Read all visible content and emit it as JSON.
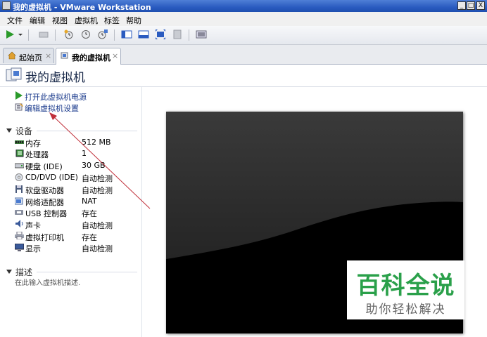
{
  "window": {
    "title": "我的虚拟机 - VMware Workstation",
    "minimize": "_",
    "maximize": "□",
    "close": "X"
  },
  "menu": [
    "文件",
    "编辑",
    "视图",
    "虚拟机",
    "标签",
    "帮助"
  ],
  "tabs": [
    {
      "label": "起始页",
      "close": "×",
      "active": false
    },
    {
      "label": "我的虚拟机",
      "close": "×",
      "active": true
    }
  ],
  "vm": {
    "title": "我的虚拟机"
  },
  "actions": {
    "power_on": "打开此虚拟机电源",
    "edit_settings": "编辑虚拟机设置"
  },
  "devices": {
    "heading": "设备",
    "items": [
      {
        "name": "内存",
        "value": "512 MB",
        "icon": "memory-icon"
      },
      {
        "name": "处理器",
        "value": "1",
        "icon": "processor-icon"
      },
      {
        "name": "硬盘 (IDE)",
        "value": "30 GB",
        "icon": "harddisk-icon"
      },
      {
        "name": "CD/DVD (IDE)",
        "value": "自动检测",
        "icon": "cdrom-icon"
      },
      {
        "name": "软盘驱动器",
        "value": "自动检测",
        "icon": "floppy-icon"
      },
      {
        "name": "网络适配器",
        "value": "NAT",
        "icon": "network-icon"
      },
      {
        "name": "USB 控制器",
        "value": "存在",
        "icon": "usb-icon"
      },
      {
        "name": "声卡",
        "value": "自动检测",
        "icon": "sound-icon"
      },
      {
        "name": "虚拟打印机",
        "value": "存在",
        "icon": "printer-icon"
      },
      {
        "name": "显示",
        "value": "自动检测",
        "icon": "display-icon"
      }
    ]
  },
  "description": {
    "heading": "描述",
    "placeholder": "在此输入虚拟机描述."
  },
  "watermark": {
    "main": "百科全说",
    "sub": "助你轻松解决"
  },
  "colors": {
    "titlebar": "#2a5bc0",
    "link": "#1a3a8c",
    "annotation_arrow": "#c0303a",
    "watermark_green": "#2aa04a"
  }
}
